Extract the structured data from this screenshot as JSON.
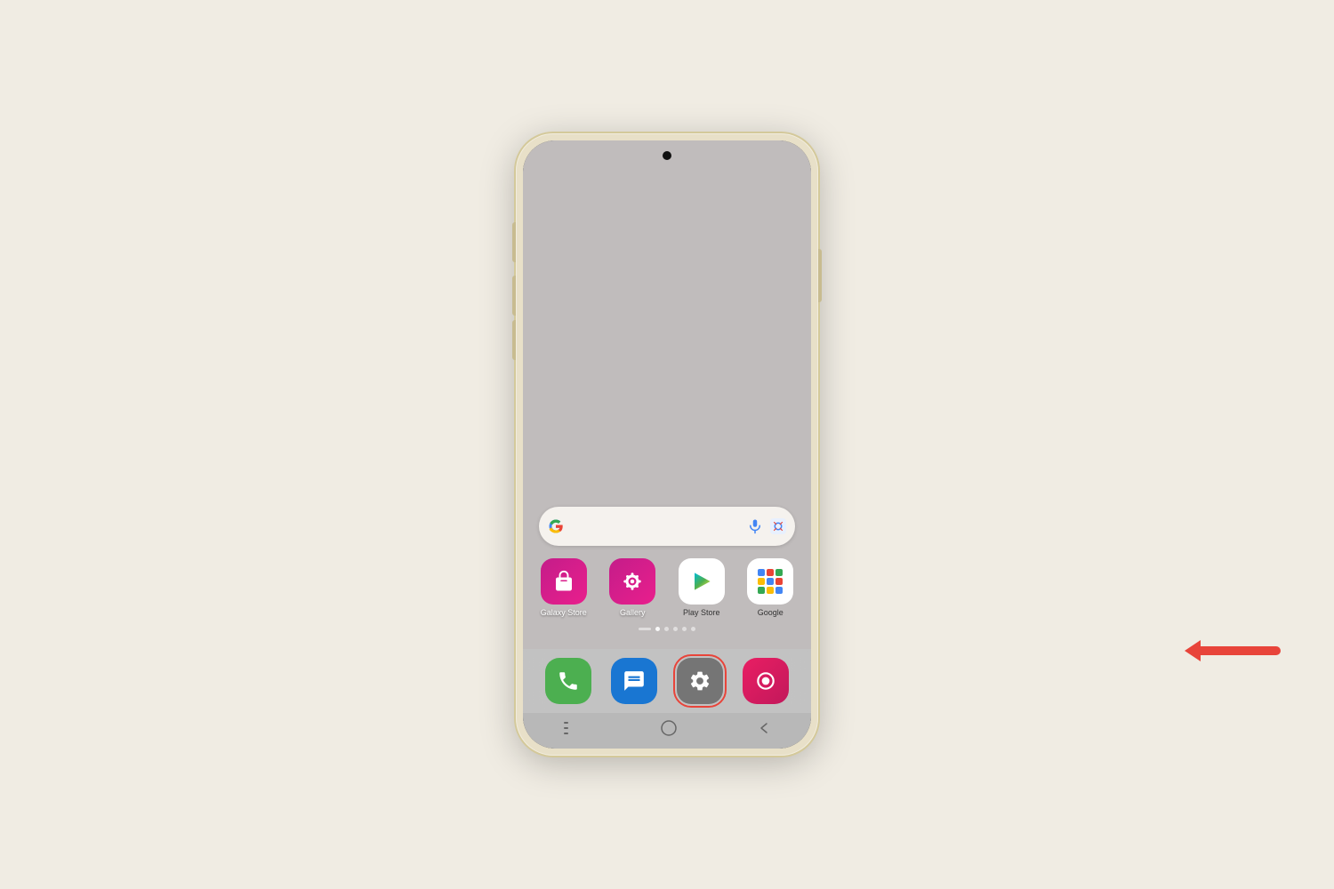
{
  "background_color": "#f0ece3",
  "phone": {
    "shell_color": "#e8e0c8",
    "screen_bg": "#c0bcbc"
  },
  "search_bar": {
    "google_letter": "G",
    "placeholder": ""
  },
  "app_grid": [
    {
      "id": "galaxy-store",
      "label": "Galaxy Store",
      "bg": "#d81b8a",
      "icon_type": "galaxy_store"
    },
    {
      "id": "gallery",
      "label": "Gallery",
      "bg": "#d81b8a",
      "icon_type": "gallery"
    },
    {
      "id": "play-store",
      "label": "Play Store",
      "bg": "#ffffff",
      "icon_type": "play_store"
    },
    {
      "id": "google",
      "label": "Google",
      "bg": "#ffffff",
      "icon_type": "google"
    }
  ],
  "page_indicators": {
    "total": 6,
    "active_index": 1,
    "has_line": true
  },
  "dock": [
    {
      "id": "phone",
      "bg": "#4caf50",
      "icon_type": "phone"
    },
    {
      "id": "messages",
      "bg": "#1976d2",
      "icon_type": "messages"
    },
    {
      "id": "settings",
      "bg": "#757575",
      "icon_type": "settings",
      "highlighted": true
    },
    {
      "id": "screen-recorder",
      "bg": "#e91e63",
      "icon_type": "recorder"
    }
  ],
  "nav": {
    "recent": "|||",
    "home": "○",
    "back": "<"
  },
  "arrow": {
    "color": "#e8443a",
    "direction": "left"
  }
}
